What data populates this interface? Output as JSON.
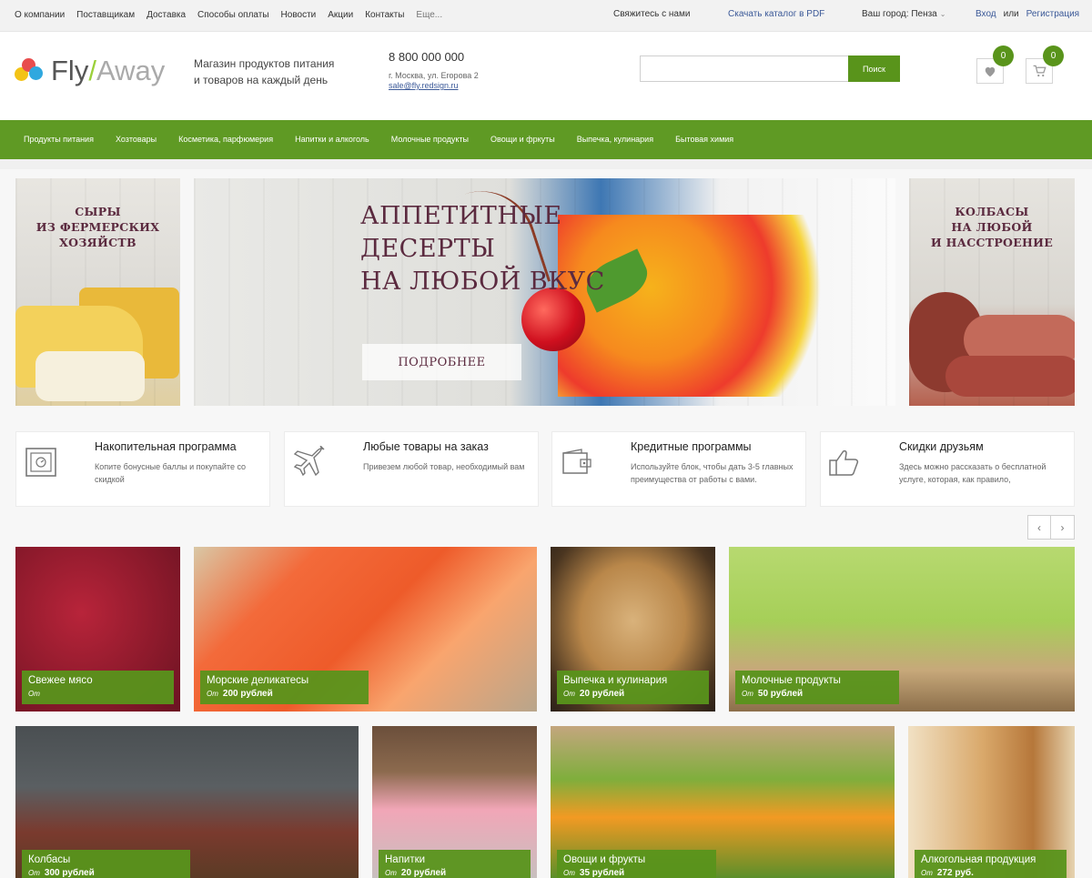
{
  "topbar": {
    "links": [
      "О компании",
      "Поставщикам",
      "Доставка",
      "Способы оплаты",
      "Новости",
      "Акции",
      "Контакты",
      "Еще..."
    ],
    "contact": "Свяжитесь с нами",
    "catalog": "Скачать каталог в PDF",
    "city": "Ваш город: Пенза",
    "login": "Вход",
    "or": "или",
    "register": "Регистрация"
  },
  "header": {
    "logo_fly": "Fly",
    "logo_slash": "/",
    "logo_away": "Away",
    "tagline_line1": "Магазин продуктов питания",
    "tagline_line2": "и товаров на каждый день",
    "phone": "8 800 000 000",
    "address": "г. Москва, ул. Егорова 2",
    "email": "sale@fly.redsign.ru",
    "search_placeholder": "",
    "search_button": "Поиск",
    "favorites_count": "0",
    "cart_count": "0"
  },
  "nav": {
    "items": [
      "Продукты питания",
      "Хозтовары",
      "Косметика, парфюмерия",
      "Напитки и алкоголь",
      "Молочные продукты",
      "Овощи и фркуты",
      "Выпечка, кулинария",
      "Бытовая химия"
    ]
  },
  "banners": {
    "left_title": [
      "СЫРЫ",
      "ИЗ ФЕРМЕРСКИХ",
      "ХОЗЯЙСТВ"
    ],
    "main_title": [
      "АППЕТИТНЫЕ",
      "ДЕСЕРТЫ",
      "НА ЛЮБОЙ ВКУС"
    ],
    "main_button": "ПОДРОБНЕЕ",
    "right_title": [
      "КОЛБАСЫ",
      "НА ЛЮБОЙ",
      "И НАССТРОЕНИЕ"
    ]
  },
  "features": [
    {
      "title": "Накопительная программа",
      "desc": "Копите бонусные баллы и покупайте со скидкой",
      "icon": "safe-icon"
    },
    {
      "title": "Любые товары на заказ",
      "desc": "Привезем любой товар, необходимый вам",
      "icon": "airplane-icon"
    },
    {
      "title": "Кредитные программы",
      "desc": "Используйте блок, чтобы дать 3-5 главных преимущества от работы с вами.",
      "icon": "wallet-icon"
    },
    {
      "title": "Скидки друзьям",
      "desc": "Здесь можно рассказать о бесплатной услуге, которая, как правило,",
      "icon": "thumbs-up-icon"
    }
  ],
  "slider_arrows": {
    "prev": "‹",
    "next": "›"
  },
  "categories": [
    {
      "name": "Свежее мясо",
      "prefix": "От",
      "price": ""
    },
    {
      "name": "Морские деликатесы",
      "prefix": "От",
      "price": "200 рублей"
    },
    {
      "name": "Выпечка и кулинария",
      "prefix": "От",
      "price": "20 рублей"
    },
    {
      "name": "Молочные продукты",
      "prefix": "От",
      "price": "50 рублей"
    },
    {
      "name": "Колбасы",
      "prefix": "От",
      "price": "300 рублей"
    },
    {
      "name": "Напитки",
      "prefix": "От",
      "price": "20 рублей"
    },
    {
      "name": "Овощи и фрукты",
      "prefix": "От",
      "price": "35 рублей"
    },
    {
      "name": "Алкогольная продукция",
      "prefix": "От",
      "price": "272 руб."
    }
  ],
  "colors": {
    "accent": "#5f9a24",
    "banner_text": "#5b2a3f",
    "link": "#3b5998"
  }
}
